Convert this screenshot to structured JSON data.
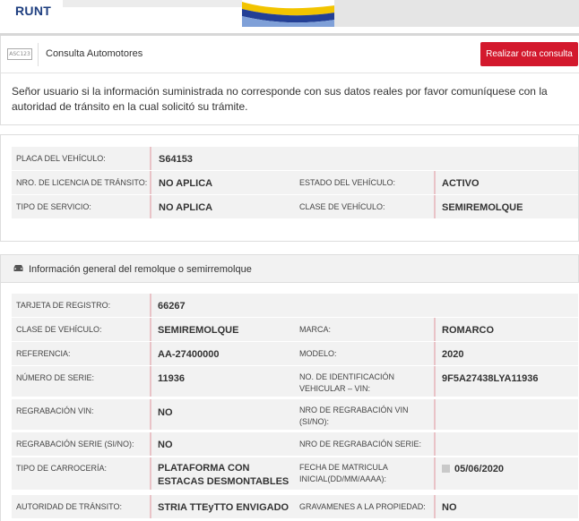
{
  "brand": {
    "logo_text": "RUNT"
  },
  "header": {
    "badge": "ASC123",
    "title": "Consulta Automotores",
    "action_button": "Realizar otra consulta"
  },
  "notice": "Señor usuario si la información suministrada no corresponde con sus datos reales por favor comuníquese con la autoridad de tránsito en la cual solicitó su trámite.",
  "vehicle": {
    "placa_label": "PLACA DEL VEHÍCULO:",
    "placa_value": "S64153",
    "licencia_label": "NRO. DE LICENCIA DE TRÁNSITO:",
    "licencia_value": "NO APLICA",
    "estado_label": "ESTADO DEL VEHÍCULO:",
    "estado_value": "ACTIVO",
    "servicio_label": "TIPO DE SERVICIO:",
    "servicio_value": "NO APLICA",
    "clase_label": "CLASE DE VEHÍCULO:",
    "clase_value": "SEMIREMOLQUE"
  },
  "remolque": {
    "section_title": "Información general del remolque o semirremolque",
    "tarjeta_label": "TARJETA DE REGISTRO:",
    "tarjeta_value": "66267",
    "clase_label": "CLASE DE VEHÍCULO:",
    "clase_value": "SEMIREMOLQUE",
    "marca_label": "MARCA:",
    "marca_value": "ROMARCO",
    "referencia_label": "REFERENCIA:",
    "referencia_value": "AA-27400000",
    "modelo_label": "MODELO:",
    "modelo_value": "2020",
    "serie_label": "NÚMERO DE SERIE:",
    "serie_value": "11936",
    "vin_label_1": "NO. DE IDENTIFICACIÓN",
    "vin_label_2": "VEHICULAR – VIN:",
    "vin_value": "9F5A27438LYA11936",
    "regrab_vin_label": "REGRABACIÓN VIN:",
    "regrab_vin_value": "NO",
    "nro_regrab_vin_label_1": "NRO DE REGRABACIÓN VIN",
    "nro_regrab_vin_label_2": "(SI/NO):",
    "nro_regrab_vin_value": "",
    "regrab_serie_label": "REGRABACIÓN SERIE (SI/NO):",
    "regrab_serie_value": "NO",
    "nro_regrab_serie_label": "NRO DE REGRABACIÓN SERIE:",
    "nro_regrab_serie_value": "",
    "carroceria_label": "TIPO DE CARROCERÍA:",
    "carroceria_value_1": "PLATAFORMA CON",
    "carroceria_value_2": "ESTACAS DESMONTABLES",
    "fecha_label_1": "FECHA DE MATRICULA",
    "fecha_label_2": "INICIAL(DD/MM/AAAA):",
    "fecha_value": "05/06/2020",
    "autoridad_label": "AUTORIDAD DE TRÁNSITO:",
    "autoridad_value": "STRIA TTEyTTO ENVIGADO",
    "gravamenes_label": "GRAVAMENES A LA PROPIEDAD:",
    "gravamenes_value": "NO"
  },
  "colors": {
    "accent_red": "#d3192d",
    "row_bg": "#f2f2f2"
  },
  "icons": {
    "header_badge": "asc-badge-icon",
    "section": "car-icon",
    "date": "calendar-icon"
  }
}
